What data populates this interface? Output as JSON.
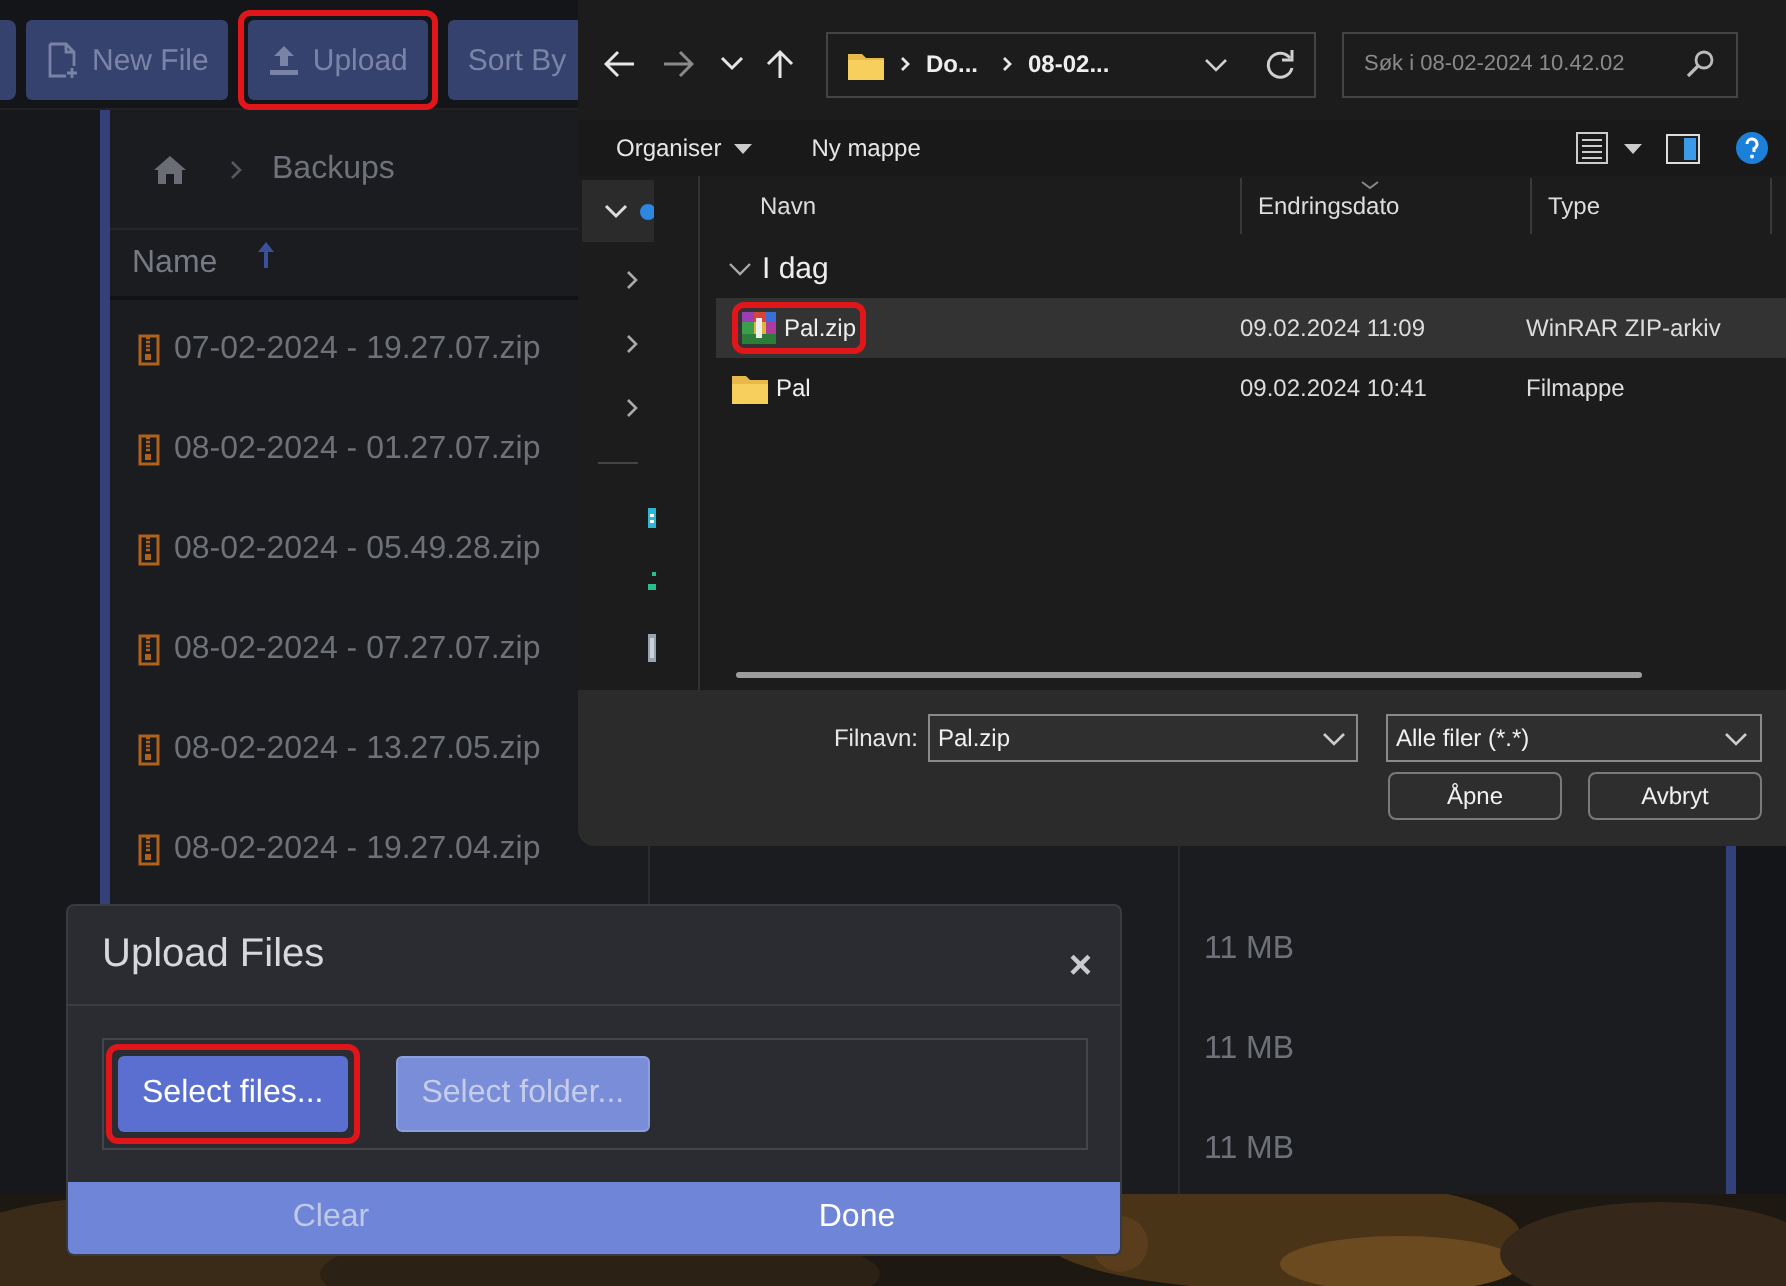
{
  "app": {
    "toolbar": [
      {
        "label": "New File",
        "kind": "create",
        "highlighted": false
      },
      {
        "label": "Upload",
        "kind": "upload",
        "highlighted": true
      },
      {
        "label": "Sort By",
        "kind": "plain",
        "highlighted": false
      }
    ],
    "breadcrumb": [
      "Backups"
    ],
    "columns": [
      {
        "label": "Name",
        "sorted": true
      }
    ],
    "rows": [
      {
        "name": "07-02-2024 - 19.27.07.zip"
      },
      {
        "name": "08-02-2024 - 01.27.07.zip"
      },
      {
        "name": "08-02-2024 - 05.49.28.zip"
      },
      {
        "name": "08-02-2024 - 07.27.07.zip"
      },
      {
        "name": "08-02-2024 - 13.27.05.zip"
      },
      {
        "name": "08-02-2024 - 19.27.04.zip"
      },
      {
        "size": "11 MB"
      },
      {
        "size": "11 MB"
      },
      {
        "size": "11 MB"
      }
    ]
  },
  "file_dialog": {
    "address": [
      "Do...",
      "08-02..."
    ],
    "search": {
      "placeholder": "Søk i 08-02-2024 10.42.02"
    },
    "commands": [
      "Organiser",
      "Ny mappe"
    ],
    "columns": [
      "Navn",
      "Endringsdato",
      "Type"
    ],
    "group": {
      "label": "I dag",
      "expanded": true
    },
    "files": [
      {
        "name": "Pal.zip",
        "modified": "09.02.2024 11:09",
        "type": "WinRAR ZIP-arkiv",
        "kind": "archive",
        "selected": true,
        "highlighted": true
      },
      {
        "name": "Pal",
        "modified": "09.02.2024 10:41",
        "type": "Filmappe",
        "kind": "folder",
        "selected": false,
        "highlighted": false
      }
    ],
    "filename": {
      "label": "Filnavn:",
      "value": "Pal.zip"
    },
    "filter": "Alle filer (*.*)",
    "buttons": [
      "Åpne",
      "Avbryt"
    ]
  },
  "upload_modal": {
    "title": "Upload Files",
    "close": "×",
    "buttons": [
      {
        "label": "Select files...",
        "kind": "primary",
        "highlighted": true
      },
      {
        "label": "Select folder...",
        "kind": "secondary",
        "highlighted": false
      }
    ],
    "footer": [
      {
        "label": "Clear",
        "kind": "muted"
      },
      {
        "label": "Done",
        "kind": "strong"
      }
    ]
  }
}
